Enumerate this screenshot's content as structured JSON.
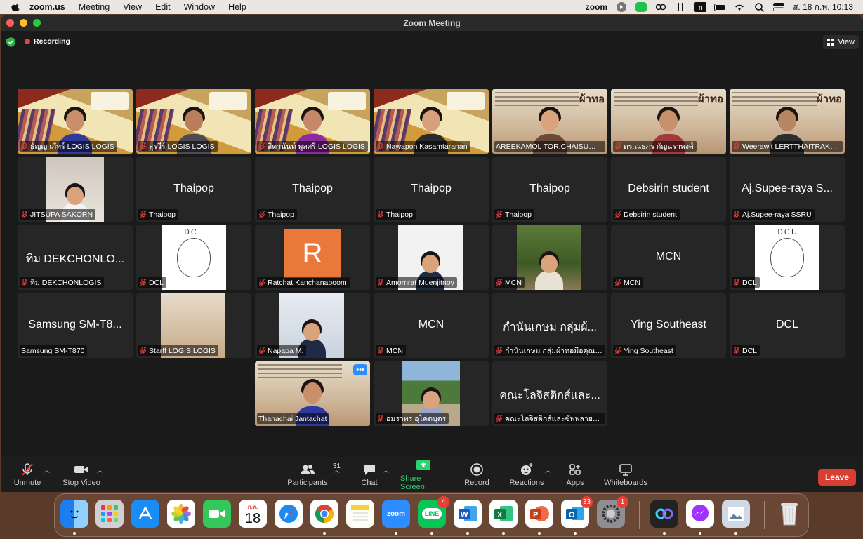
{
  "menubar": {
    "app_name": "zoom.us",
    "items": [
      "Meeting",
      "View",
      "Edit",
      "Window",
      "Help"
    ],
    "zoom_label": "zoom",
    "clock": "ส. 18 ก.พ.  10:13"
  },
  "window": {
    "title": "Zoom Meeting"
  },
  "meeting": {
    "recording_label": "Recording",
    "view_label": "View"
  },
  "tiles": [
    {
      "name": "ธัญญาภัทร์ LOGIS LOGIS",
      "display": "",
      "muted": true
    },
    {
      "name": "สุรวีร์ LOGIS LOGIS",
      "display": "",
      "muted": true
    },
    {
      "name": "สิตานันท์ พูลศรี LOGIS LOGIS",
      "display": "",
      "muted": true
    },
    {
      "name": "Nawapon Kasamtaranan",
      "display": "",
      "muted": true
    },
    {
      "name": "AREEKAMOL TOR.CHAISUWAN",
      "display": "",
      "muted": false
    },
    {
      "name": "ดร.ณธภร กัญฉราพงศ์",
      "display": "",
      "muted": true
    },
    {
      "name": "Weerawit LERTTHAITRAKU...",
      "display": "",
      "muted": true
    },
    {
      "name": "JITSUPA  SAKORN",
      "display": "",
      "muted": true
    },
    {
      "name": "Thaipop",
      "display": "Thaipop",
      "muted": true
    },
    {
      "name": "Thaipop",
      "display": "Thaipop",
      "muted": true
    },
    {
      "name": "Thaipop",
      "display": "Thaipop",
      "muted": true
    },
    {
      "name": "Thaipop",
      "display": "Thaipop",
      "muted": true
    },
    {
      "name": "Debsirin student",
      "display": "Debsirin student",
      "muted": true
    },
    {
      "name": "Aj.Supee-raya SSRU",
      "display": "Aj.Supee-raya S...",
      "muted": true
    },
    {
      "name": "ทีม DEKCHONLOGIS",
      "display": "ทีม DEKCHONLO...",
      "muted": true
    },
    {
      "name": "DCL",
      "display": "",
      "muted": true
    },
    {
      "name": "Ratchat  Kanchanapoom",
      "display": "",
      "muted": true
    },
    {
      "name": "Amornrat  Muenjitnoy",
      "display": "",
      "muted": true
    },
    {
      "name": "MCN",
      "display": "",
      "muted": true
    },
    {
      "name": "MCN",
      "display": "MCN",
      "muted": true
    },
    {
      "name": "DCL",
      "display": "",
      "muted": true
    },
    {
      "name": "Samsung SM-T870",
      "display": "Samsung SM-T8...",
      "muted": false
    },
    {
      "name": "Starff LOGIS LOGIS",
      "display": "",
      "muted": true
    },
    {
      "name": "Napapa M.",
      "display": "",
      "muted": true
    },
    {
      "name": "MCN",
      "display": "MCN",
      "muted": true
    },
    {
      "name": "กำนันเกษม กลุ่มผ้าทอมือคุณย่า...",
      "display": "กำนันเกษม กลุ่มผ้...",
      "muted": true
    },
    {
      "name": "Ying Southeast",
      "display": "Ying Southeast",
      "muted": true
    },
    {
      "name": "DCL",
      "display": "DCL",
      "muted": true
    },
    {
      "name": "Thanachai Jantachat",
      "display": "",
      "muted": false
    },
    {
      "name": "อมราพร อุโคตบุตร",
      "display": "",
      "muted": true
    },
    {
      "name": "คณะโลจิสติกส์และซัพพลายเชน...",
      "display": "คณะโลจิสติกส์และ...",
      "muted": true
    }
  ],
  "banner_text": {
    "tag": "ผ้าทอ"
  },
  "avatar_letter": "R",
  "dcl_logo_text": "DCL",
  "toolbar": {
    "unmute": "Unmute",
    "stop_video": "Stop Video",
    "participants": "Participants",
    "participants_count": "31",
    "chat": "Chat",
    "share_screen": "Share Screen",
    "record": "Record",
    "reactions": "Reactions",
    "apps": "Apps",
    "whiteboards": "Whiteboards",
    "leave": "Leave"
  },
  "dock": {
    "calendar_month": "ก.พ.",
    "calendar_day": "18",
    "zoom_label": "zoom",
    "line_label": "LINE",
    "line_badge": "4",
    "outlook_badge": "33",
    "settings_badge": "1"
  },
  "colors": {
    "accent_green": "#2bd36a",
    "leave_red": "#d73f35",
    "recording_red": "#e0463f"
  }
}
